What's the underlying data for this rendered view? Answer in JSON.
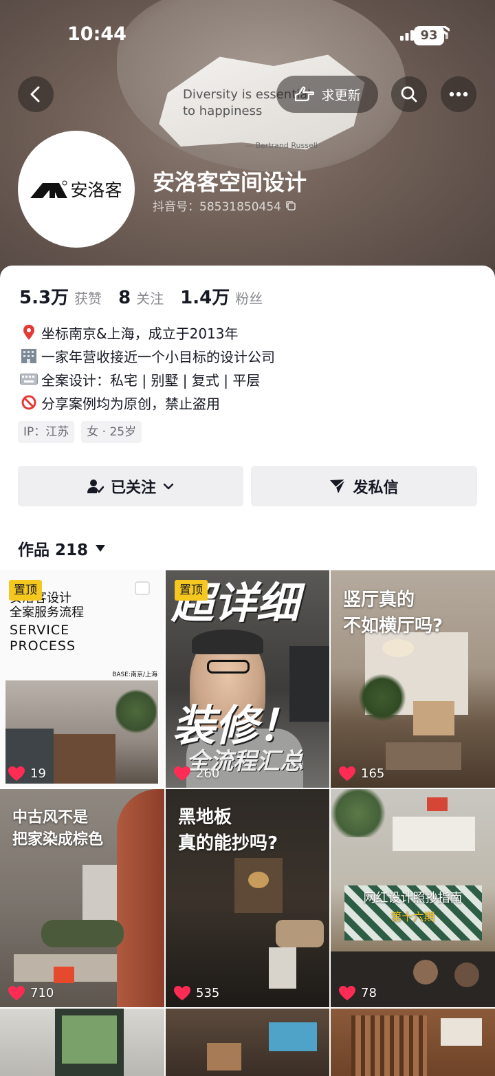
{
  "status": {
    "time": "10:44",
    "battery": "93"
  },
  "header": {
    "update_label": "求更新",
    "quote_text": "Diversity is essential to happiness",
    "quote_author": "— Bertrand Russell"
  },
  "profile": {
    "avatar_brand": "安洛客",
    "nickname": "安洛客空间设计",
    "account_id": "抖音号：58531850454"
  },
  "stats": [
    {
      "value": "5.3万",
      "label": "获赞"
    },
    {
      "value": "8",
      "label": "关注"
    },
    {
      "value": "1.4万",
      "label": "粉丝"
    }
  ],
  "bio": [
    {
      "icon": "pin-icon",
      "text": "坐标南京&上海，成立于2013年"
    },
    {
      "icon": "building-icon",
      "text": "一家年营收接近一个小目标的设计公司"
    },
    {
      "icon": "keyboard-icon",
      "text": "全案设计：私宅 | 别墅 | 复式 | 平层"
    },
    {
      "icon": "prohibited-icon",
      "text": "分享案例均为原创，禁止盗用"
    }
  ],
  "tags": [
    "IP：江苏",
    "女 · 25岁"
  ],
  "actions": {
    "follow_label": "已关注",
    "message_label": "发私信"
  },
  "works": {
    "label": "作品 218"
  },
  "posts": [
    {
      "pinned": "置顶",
      "title": "安洛客设计\n全案服务流程",
      "subtitle": "SERVICE\nPROCESS",
      "base": "BASE:南京/上海",
      "likes": "19"
    },
    {
      "pinned": "置顶",
      "title": "超详细",
      "title2": "装修！",
      "title3": "全流程汇总",
      "likes": "260"
    },
    {
      "title": "竖厅真的\n不如横厅吗?",
      "likes": "165"
    },
    {
      "title": "中古风不是\n把家染成棕色",
      "likes": "710"
    },
    {
      "title": "黑地板\n真的能抄吗?",
      "likes": "535"
    },
    {
      "title": "网红设计照抄指南",
      "subtitle": "第十六期",
      "likes": "78"
    }
  ],
  "colors": {
    "pin": "#f5c81f",
    "like": "#fe2c55",
    "text": "#161823",
    "secondary": "#8a8b91"
  }
}
